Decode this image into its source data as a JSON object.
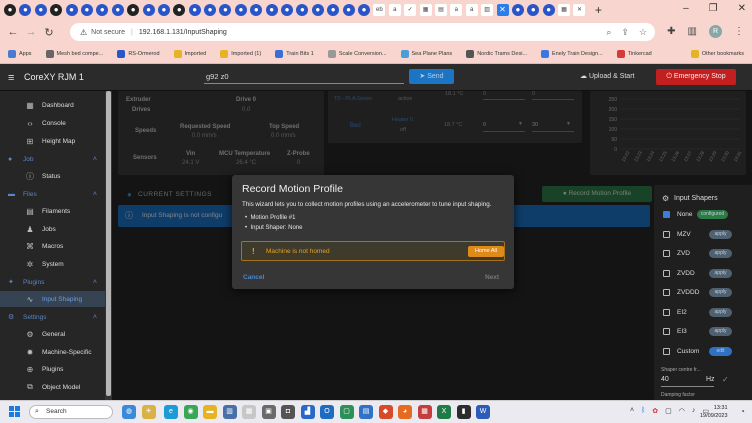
{
  "browser": {
    "tab_icons": [
      "github",
      "jellyfin",
      "jellyfin",
      "github",
      "jellyfin",
      "jellyfin",
      "jellyfin",
      "jellyfin",
      "github",
      "jellyfin",
      "jellyfin",
      "github",
      "jellyfin",
      "jellyfin",
      "jellyfin",
      "jellyfin",
      "jellyfin",
      "jellyfin",
      "jellyfin",
      "jellyfin",
      "jellyfin",
      "jellyfin",
      "jellyfin",
      "jellyfin",
      "ebay",
      "amazon",
      "check",
      "grid",
      "calc",
      "a",
      "amazon",
      "chart",
      "close-tab",
      "jellyfin",
      "jellyfin",
      "jellyfin",
      "calendar",
      "close"
    ],
    "new_tab": "+",
    "window_controls": [
      "–",
      "❐",
      "✕"
    ],
    "url_security": "Not secure",
    "url": "192.168.1.131/InputShaping",
    "bookmarks": [
      {
        "label": "Apps",
        "color": "#4a7bd1"
      },
      {
        "label": "Mesh bed compe...",
        "color": "#666"
      },
      {
        "label": "RS-Ormerod",
        "color": "#2a55c8"
      },
      {
        "label": "Imported",
        "color": "#e6b325"
      },
      {
        "label": "Imported (1)",
        "color": "#e6b325"
      },
      {
        "label": "Train Bits 1",
        "color": "#3a6ed6"
      },
      {
        "label": "Scale Conversion...",
        "color": "#999"
      },
      {
        "label": "Sea Plane Plans",
        "color": "#4a9ed6"
      },
      {
        "label": "Nordic Trams Desi...",
        "color": "#555"
      },
      {
        "label": "Enely Train Design...",
        "color": "#3a78e0"
      },
      {
        "label": "Tinkercad",
        "color": "#d53b3b"
      }
    ],
    "other_bookmarks": "Other bookmarks",
    "profile_initial": "R"
  },
  "app": {
    "title": "CoreXY RJM 1",
    "gcode_value": "g92 z0",
    "send_label": "Send",
    "upload_label": "Upload & Start",
    "estop_label": "Emergency Stop"
  },
  "sidebar": {
    "items": [
      {
        "type": "item",
        "label": "Dashboard",
        "icon": "dashboard-icon",
        "glyph": "▦",
        "top": 6
      },
      {
        "type": "item",
        "label": "Console",
        "icon": "console-icon",
        "glyph": "‹›",
        "top": 24
      },
      {
        "type": "item",
        "label": "Height Map",
        "icon": "grid-icon",
        "glyph": "⊞",
        "top": 42
      },
      {
        "type": "section",
        "label": "Job",
        "icon": "job-icon",
        "glyph": "●",
        "top": 60
      },
      {
        "type": "item",
        "label": "Status",
        "icon": "info-icon",
        "glyph": "ⓘ",
        "top": 77
      },
      {
        "type": "section",
        "label": "Files",
        "icon": "files-icon",
        "glyph": "▬",
        "top": 95
      },
      {
        "type": "item",
        "label": "Filaments",
        "icon": "filament-icon",
        "glyph": "▤",
        "top": 112
      },
      {
        "type": "item",
        "label": "Jobs",
        "icon": "print-icon",
        "glyph": "♟",
        "top": 130
      },
      {
        "type": "item",
        "label": "Macros",
        "icon": "macro-icon",
        "glyph": "⌘",
        "top": 147
      },
      {
        "type": "item",
        "label": "System",
        "icon": "settings-icon",
        "glyph": "✲",
        "top": 165
      },
      {
        "type": "section",
        "label": "Plugins",
        "icon": "plugin-icon",
        "glyph": "✦",
        "top": 183
      },
      {
        "type": "item",
        "label": "Input Shaping",
        "icon": "shaping-icon",
        "glyph": "∿",
        "top": 200,
        "active": true
      },
      {
        "type": "section",
        "label": "Settings",
        "icon": "gear-icon",
        "glyph": "⚙",
        "top": 218
      },
      {
        "type": "item",
        "label": "General",
        "icon": "general-icon",
        "glyph": "⚙",
        "top": 235
      },
      {
        "type": "item",
        "label": "Machine-Specific",
        "icon": "machine-icon",
        "glyph": "✹",
        "top": 253
      },
      {
        "type": "item",
        "label": "Plugins",
        "icon": "plugins-icon",
        "glyph": "⊕",
        "top": 270
      },
      {
        "type": "item",
        "label": "Object Model",
        "icon": "tree-icon",
        "glyph": "⧉",
        "top": 288
      }
    ]
  },
  "status_card": {
    "row1": [
      "Extruder",
      "Drives",
      "Drive 0",
      "0.0"
    ],
    "speeds_label": "Speeds",
    "requested_label": "Requested Speed",
    "requested_value": "0.0 mm/s",
    "top_label": "Top Speed",
    "top_value": "0.0 mm/s",
    "sensors_label": "Sensors",
    "vin_label": "Vin",
    "vin_value": "24.1 V",
    "mcu_label": "MCU Temperature",
    "mcu_value": "26.4 °C",
    "zprobe_label": "Z-Probe",
    "zprobe_value": "0"
  },
  "heaters": {
    "t0_label": "T0 - PLA Green",
    "t0_state": "active",
    "t0_temp": "18.1 °C",
    "t0_active": "0",
    "t0_standby": "0",
    "bed_label": "Bed",
    "bed_heater": "Heater 0",
    "bed_state": "off",
    "bed_temp": "18.7 °C",
    "bed_active": "0",
    "bed_standby": "30"
  },
  "temp_chart": {
    "y_ticks": [
      "250",
      "200",
      "150",
      "100",
      "50",
      "0"
    ],
    "x_ticks": [
      "13:22",
      "13:23",
      "13:24",
      "13:25",
      "13:26",
      "13:27",
      "13:28",
      "13:29",
      "13:30",
      "13:31"
    ]
  },
  "shaping": {
    "tab_label": "CURRENT SETTINGS",
    "info_text": "Input Shaping is not configu",
    "record_btn": "Record Motion Profile",
    "shapers_title": "Input Shapers",
    "shapers": [
      {
        "name": "None",
        "chip": "configured",
        "checked": true
      },
      {
        "name": "MZV",
        "chip": "apply"
      },
      {
        "name": "ZVD",
        "chip": "apply"
      },
      {
        "name": "ZVDD",
        "chip": "apply"
      },
      {
        "name": "ZVDDD",
        "chip": "apply"
      },
      {
        "name": "EI2",
        "chip": "apply"
      },
      {
        "name": "EI3",
        "chip": "apply"
      },
      {
        "name": "Custom",
        "chip": "edit"
      }
    ],
    "center_label": "Shaper centre fr...",
    "center_value": "40",
    "center_unit": "Hz",
    "damping_label": "Damping factor"
  },
  "modal": {
    "title": "Record Motion Profile",
    "subtitle": "This wizard lets you to collect motion profiles using an accelerometer to tune input shaping.",
    "bullets": [
      "Motion Profile #1",
      "Input Shaper: None"
    ],
    "alert_icon": "!",
    "alert_text": "Machine is not homed",
    "home_all": "Home All",
    "cancel": "Cancel",
    "next": "Next"
  },
  "taskbar": {
    "search": "Search",
    "time": "13:31",
    "date": "19/09/2023",
    "apps": [
      {
        "name": "copilot-icon",
        "color": "#3a8ad8",
        "glyph": "◍"
      },
      {
        "name": "weather-icon",
        "color": "#d9b144",
        "glyph": "☀"
      },
      {
        "name": "edge-icon",
        "color": "#1c9bd6",
        "glyph": "e"
      },
      {
        "name": "chrome-icon",
        "color": "#3aa757",
        "glyph": "◉"
      },
      {
        "name": "explorer-icon",
        "color": "#e6b325",
        "glyph": "▬"
      },
      {
        "name": "app-icon",
        "color": "#4a6ea8",
        "glyph": "▥"
      },
      {
        "name": "app-icon",
        "color": "#c7c7c7",
        "glyph": "▦"
      },
      {
        "name": "app-icon",
        "color": "#6a6a6a",
        "glyph": "▣"
      },
      {
        "name": "camera-icon",
        "color": "#555",
        "glyph": "◘"
      },
      {
        "name": "app-icon",
        "color": "#2a68c8",
        "glyph": "▟"
      },
      {
        "name": "outlook-icon",
        "color": "#1b6cc2",
        "glyph": "O"
      },
      {
        "name": "app-icon",
        "color": "#2f8f5a",
        "glyph": "▢"
      },
      {
        "name": "app-icon",
        "color": "#3172c6",
        "glyph": "▤"
      },
      {
        "name": "app-icon",
        "color": "#d64a2a",
        "glyph": "◆"
      },
      {
        "name": "firefox-icon",
        "color": "#e66a1f",
        "glyph": "◕"
      },
      {
        "name": "app-icon",
        "color": "#c43e3e",
        "glyph": "▦"
      },
      {
        "name": "excel-icon",
        "color": "#1f7a45",
        "glyph": "X"
      },
      {
        "name": "app-icon",
        "color": "#2c2c2c",
        "glyph": "▮"
      },
      {
        "name": "word-icon",
        "color": "#2a5cb8",
        "glyph": "W"
      }
    ]
  }
}
